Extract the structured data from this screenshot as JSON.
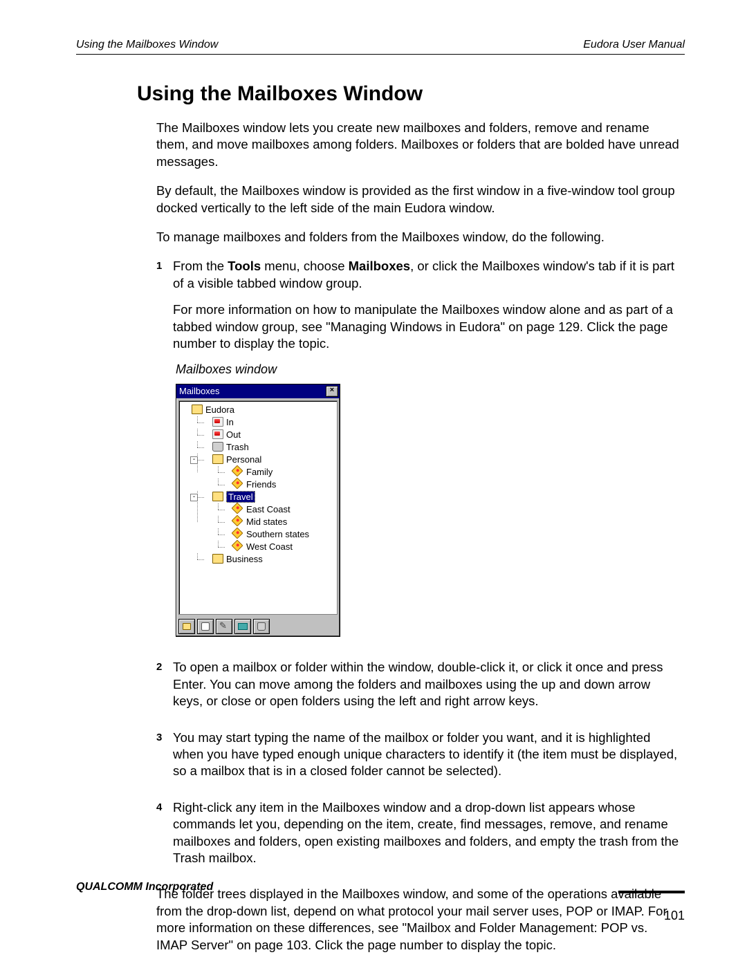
{
  "header": {
    "left": "Using the Mailboxes Window",
    "right": "Eudora User Manual"
  },
  "title": "Using the Mailboxes Window",
  "intro": [
    "The Mailboxes window lets you create new mailboxes and folders, remove and rename them, and move mailboxes among folders. Mailboxes or folders that are bolded have unread messages.",
    "By default, the Mailboxes window is provided as the first window in a five-window tool group docked vertically to the left side of the main Eudora window.",
    "To manage mailboxes and folders from the Mailboxes window, do the following."
  ],
  "steps": {
    "s1": {
      "num": "1",
      "a_pre": "From the ",
      "a_b1": "Tools",
      "a_mid": " menu, choose ",
      "a_b2": "Mailboxes",
      "a_post": ", or click the Mailboxes window's tab if it is part of a visible tabbed window group.",
      "b": "For more information on how to manipulate the Mailboxes window alone and as part of a tabbed window group, see \"Managing Windows in Eudora\" on page 129. Click the page number to display the topic."
    },
    "s2": {
      "num": "2",
      "text": "To open a mailbox or folder within the window, double-click it, or click it once and press Enter. You can move among the folders and mailboxes using the up and down arrow keys, or close or open folders using the left and right arrow keys."
    },
    "s3": {
      "num": "3",
      "text": "You may start typing the name of the mailbox or folder you want, and it is highlighted when you have typed enough unique characters to identify it (the item must be displayed, so a mailbox that is in a closed folder cannot be selected)."
    },
    "s4": {
      "num": "4",
      "text": "Right-click any item in the Mailboxes window and a drop-down list appears whose commands let you, depending on the item, create, find messages, remove, and rename mailboxes and folders, open existing mailboxes and folders, and empty the trash from the Trash mailbox."
    }
  },
  "closing": "The folder trees displayed in the Mailboxes window, and some of the operations available from the drop-down list, depend on what protocol your mail server uses, POP or IMAP. For more information on these differences, see \"Mailbox and Folder Management: POP vs. IMAP Server\" on page 103. Click the page number to display the topic.",
  "figure": {
    "caption": "Mailboxes window",
    "title": "Mailboxes",
    "close_glyph": "×",
    "expander_glyph": "-",
    "tree": {
      "root": "Eudora",
      "in": "In",
      "out": "Out",
      "trash": "Trash",
      "personal": "Personal",
      "family": "Family",
      "friends": "Friends",
      "travel": "Travel",
      "east": "East Coast",
      "mid": "Mid states",
      "south": "Southern states",
      "west": "West Coast",
      "business": "Business"
    }
  },
  "footer": {
    "company": "QUALCOMM Incorporated",
    "page": "101"
  }
}
